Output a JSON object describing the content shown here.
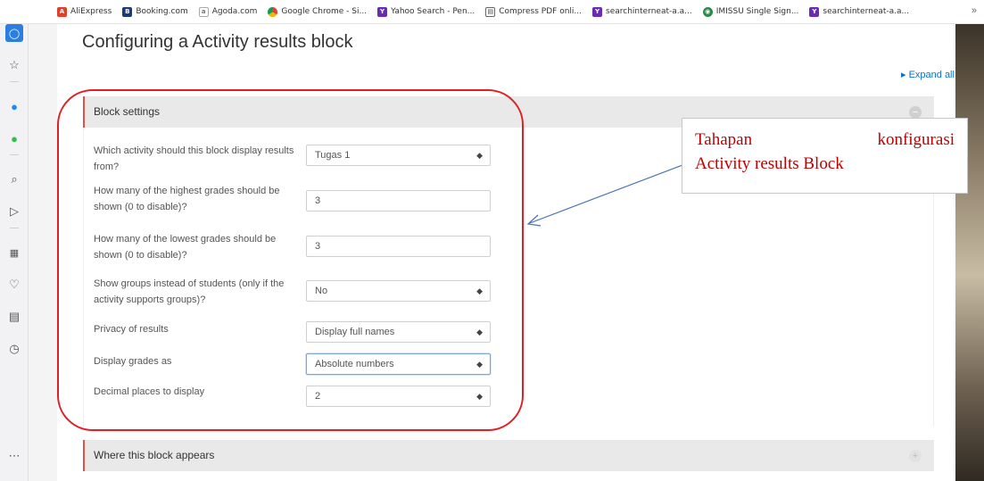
{
  "bookmarks": [
    {
      "label": "AliExpress",
      "icon": "aliexpress-icon",
      "color": "#e0412b"
    },
    {
      "label": "Booking.com",
      "icon": "booking-icon",
      "color": "#1a3a7a"
    },
    {
      "label": "Agoda.com",
      "icon": "agoda-icon",
      "color": "#999999"
    },
    {
      "label": "Google Chrome - Si...",
      "icon": "chrome-icon",
      "color": "#e8a12e"
    },
    {
      "label": "Yahoo Search - Pen...",
      "icon": "yahoo-icon",
      "color": "#6a2bb4"
    },
    {
      "label": "Compress PDF onli...",
      "icon": "pdf-icon",
      "color": "#444444"
    },
    {
      "label": "searchinterneat-a.a...",
      "icon": "yahoo-icon",
      "color": "#6a2bb4"
    },
    {
      "label": "IMISSU Single Sign...",
      "icon": "imissu-icon",
      "color": "#2a8a4a"
    },
    {
      "label": "searchinterneat-a.a...",
      "icon": "yahoo-icon",
      "color": "#6a2bb4"
    }
  ],
  "bookmarks_more": "»",
  "page": {
    "title": "Configuring a Activity results block",
    "expand_all": "Expand all"
  },
  "sections": {
    "block_settings": "Block settings",
    "where_appears": "Where this block appears"
  },
  "form": {
    "fields": [
      {
        "label": "Which activity should this block display results from?",
        "value": "Tugas 1",
        "type": "select"
      },
      {
        "label": "How many of the highest grades should be shown (0 to disable)?",
        "value": "3",
        "type": "text"
      },
      {
        "label": "How many of the lowest grades should be shown (0 to disable)?",
        "value": "3",
        "type": "text"
      },
      {
        "label": "Show groups instead of students (only if the activity supports groups)?",
        "value": "No",
        "type": "select"
      },
      {
        "label": "Privacy of results",
        "value": "Display full names",
        "type": "select"
      },
      {
        "label": "Display grades as",
        "value": "Absolute numbers",
        "type": "select"
      },
      {
        "label": "Decimal places to display",
        "value": "2",
        "type": "select"
      }
    ]
  },
  "annotation": {
    "word1": "Tahapan",
    "word2": "konfigurasi",
    "line2": "Activity results Block",
    "color": "#c00000"
  },
  "colors": {
    "accent_red": "#e31f26",
    "link": "#0f6fc5"
  }
}
